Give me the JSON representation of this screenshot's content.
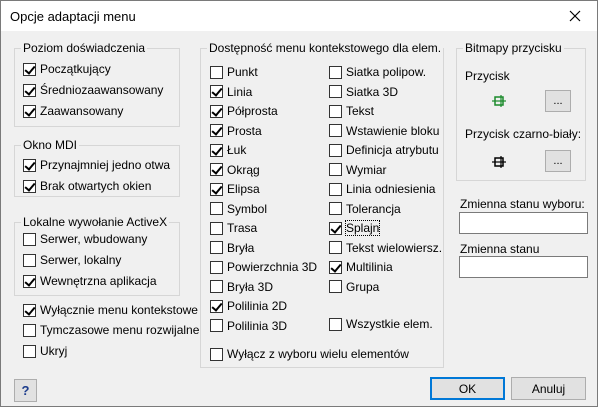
{
  "window": {
    "title": "Opcje adaptacji menu"
  },
  "experience": {
    "legend": "Poziom doświadczenia",
    "items": [
      {
        "label": "Początkujący",
        "checked": true
      },
      {
        "label": "Średniozaawansowany",
        "checked": true
      },
      {
        "label": "Zaawansowany",
        "checked": true
      }
    ]
  },
  "mdi": {
    "legend": "Okno MDI",
    "items": [
      {
        "label": "Przynajmniej jedno otwa",
        "checked": true
      },
      {
        "label": "Brak otwartych okien",
        "checked": true
      }
    ]
  },
  "activex": {
    "legend": "Lokalne wywołanie ActiveX",
    "items": [
      {
        "label": "Serwer, wbudowany",
        "checked": false
      },
      {
        "label": "Serwer, lokalny",
        "checked": false
      },
      {
        "label": "Wewnętrzna aplikacja",
        "checked": true
      }
    ]
  },
  "misc": {
    "items": [
      {
        "label": "Wyłącznie menu kontekstowe",
        "checked": true
      },
      {
        "label": "Tymczasowe menu rozwijalne",
        "checked": false
      },
      {
        "label": "Ukryj",
        "checked": false
      }
    ]
  },
  "context": {
    "legend": "Dostępność menu kontekstowego dla elem.",
    "col1": [
      {
        "label": "Punkt",
        "checked": false
      },
      {
        "label": "Linia",
        "checked": true
      },
      {
        "label": "Półprosta",
        "checked": true
      },
      {
        "label": "Prosta",
        "checked": true
      },
      {
        "label": "Łuk",
        "checked": true
      },
      {
        "label": "Okrąg",
        "checked": true
      },
      {
        "label": "Elipsa",
        "checked": true
      },
      {
        "label": "Symbol",
        "checked": false
      },
      {
        "label": "Trasa",
        "checked": false
      },
      {
        "label": "Bryła",
        "checked": false
      },
      {
        "label": "Powierzchnia 3D",
        "checked": false
      },
      {
        "label": "Bryła 3D",
        "checked": false
      },
      {
        "label": "Polilinia 2D",
        "checked": true
      },
      {
        "label": "Polilinia 3D",
        "checked": false
      }
    ],
    "col2": [
      {
        "label": "Siatka polipow.",
        "checked": false
      },
      {
        "label": "Siatka 3D",
        "checked": false
      },
      {
        "label": "Tekst",
        "checked": false
      },
      {
        "label": "Wstawienie bloku",
        "checked": false
      },
      {
        "label": "Definicja atrybutu",
        "checked": false
      },
      {
        "label": "Wymiar",
        "checked": false
      },
      {
        "label": "Linia odniesienia",
        "checked": false
      },
      {
        "label": "Tolerancja",
        "checked": false
      },
      {
        "label": "Splajn",
        "checked": true
      },
      {
        "label": "Tekst wielowiersz.",
        "checked": false
      },
      {
        "label": "Multilinia",
        "checked": true
      },
      {
        "label": "Grupa",
        "checked": false
      }
    ],
    "all_label": "Wszystkie elem.",
    "all_checked": false,
    "exclude_label": "Wyłącz z wyboru wielu elementów",
    "exclude_checked": false
  },
  "bitmaps": {
    "legend": "Bitmapy przycisku",
    "button_label": "Przycisk",
    "bw_label": "Przycisk czarno-biały:",
    "browse_label": "..."
  },
  "selection_var": {
    "label": "Zmienna stanu wyboru:",
    "value": ""
  },
  "state_var": {
    "label": "Zmienna stanu",
    "value": ""
  },
  "buttons": {
    "ok": "OK",
    "cancel": "Anuluj",
    "help": "?"
  }
}
